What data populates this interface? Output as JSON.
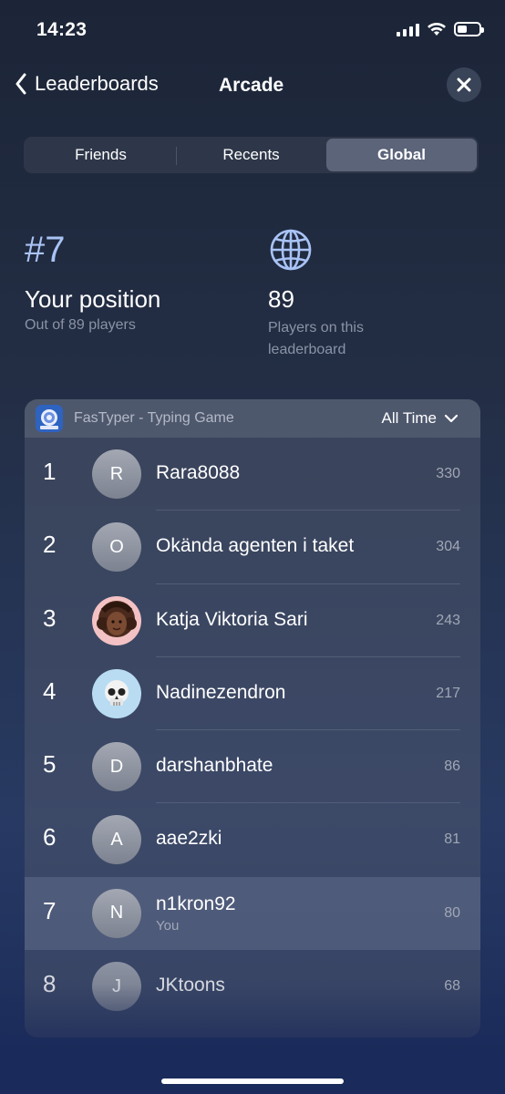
{
  "status": {
    "time": "14:23"
  },
  "nav": {
    "back_label": "Leaderboards",
    "title": "Arcade"
  },
  "tabs": [
    {
      "label": "Friends",
      "active": false
    },
    {
      "label": "Recents",
      "active": false
    },
    {
      "label": "Global",
      "active": true
    }
  ],
  "stats": {
    "rank": "#7",
    "position_label": "Your position",
    "position_sub": "Out of 89 players",
    "count": "89",
    "count_sub": "Players on this leaderboard"
  },
  "leaderboard": {
    "game_name": "FasTyper - Typing Game",
    "time_filter": "All Time",
    "rows": [
      {
        "rank": "1",
        "initial": "R",
        "name": "Rara8088",
        "score": "330"
      },
      {
        "rank": "2",
        "initial": "O",
        "name": "Okända agenten i taket",
        "score": "304"
      },
      {
        "rank": "3",
        "initial": "",
        "name": "Katja Viktoria Sari",
        "score": "243"
      },
      {
        "rank": "4",
        "initial": "",
        "name": "Nadinezendron",
        "score": "217"
      },
      {
        "rank": "5",
        "initial": "D",
        "name": "darshanbhate",
        "score": "86"
      },
      {
        "rank": "6",
        "initial": "A",
        "name": "aae2zki",
        "score": "81"
      },
      {
        "rank": "7",
        "initial": "N",
        "name": "n1kron92",
        "score": "80",
        "you": "You"
      },
      {
        "rank": "8",
        "initial": "J",
        "name": "JKtoons",
        "score": "68"
      }
    ]
  }
}
